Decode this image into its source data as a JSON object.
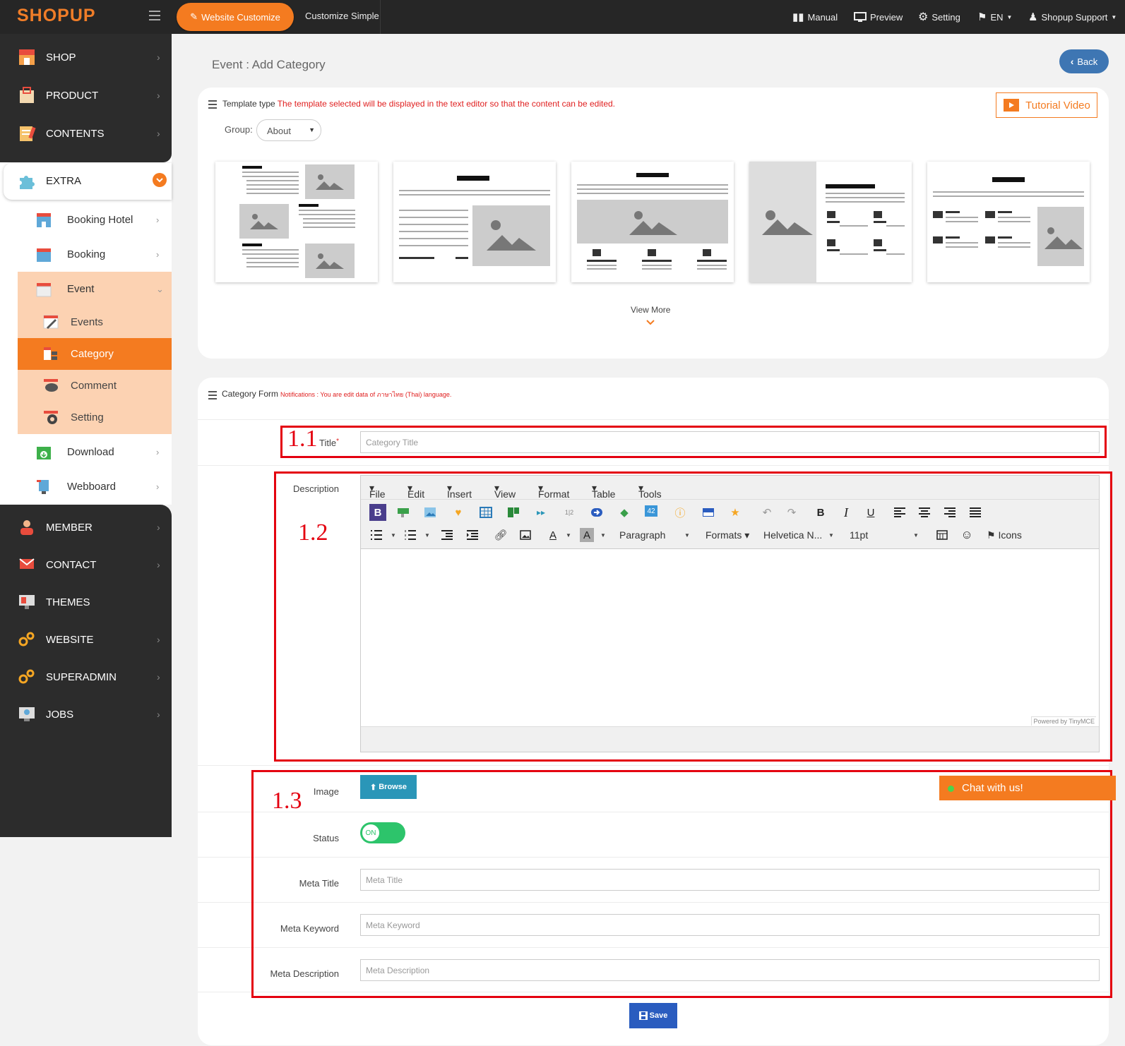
{
  "topbar": {
    "logo": "SHOPUP",
    "website_customize": "Website Customize",
    "customize_simple": "Customize Simple",
    "manual": "Manual",
    "preview": "Preview",
    "setting": "Setting",
    "language": "EN",
    "support": "Shopup Support"
  },
  "sidebar": {
    "shop": "SHOP",
    "product": "PRODUCT",
    "contents": "CONTENTS",
    "extra": "EXTRA",
    "booking_hotel": "Booking Hotel",
    "booking": "Booking",
    "event": "Event",
    "events": "Events",
    "category": "Category",
    "comment": "Comment",
    "setting": "Setting",
    "download": "Download",
    "webboard": "Webboard",
    "member": "MEMBER",
    "contact": "CONTACT",
    "themes": "THEMES",
    "website": "WEBSITE",
    "superadmin": "SUPERADMIN",
    "jobs": "JOBS"
  },
  "page": {
    "title": "Event : Add Category",
    "back": "Back"
  },
  "template_panel": {
    "label": "Template type",
    "notice": "The template selected will be displayed in the text editor so that the content can be edited.",
    "tutorial": "Tutorial Video",
    "group_label": "Group:",
    "group_value": "About",
    "view_more": "View More"
  },
  "form": {
    "header": "Category Form",
    "notice": "Notifications : You are edit data of ภาษาไทย (Thai) language.",
    "title_label": "Title",
    "required": "*",
    "title_placeholder": "Category Title",
    "description_label": "Description",
    "image_label": "Image",
    "browse": "Browse",
    "status_label": "Status",
    "status_value": "ON",
    "meta_title_label": "Meta Title",
    "meta_title_placeholder": "Meta Title",
    "meta_keyword_label": "Meta Keyword",
    "meta_keyword_placeholder": "Meta Keyword",
    "meta_description_label": "Meta Description",
    "meta_description_placeholder": "Meta Description",
    "save": "Save"
  },
  "editor": {
    "menus": [
      "File",
      "Edit",
      "Insert",
      "View",
      "Format",
      "Table",
      "Tools"
    ],
    "paragraph": "Paragraph",
    "formats": "Formats",
    "font": "Helvetica N...",
    "size": "11pt",
    "icons": "Icons",
    "powered": "Powered by TinyMCE"
  },
  "annotations": {
    "a1": "1.1",
    "a2": "1.2",
    "a3": "1.3"
  },
  "chat": "Chat with us!",
  "colors": {
    "accent": "#f47b20",
    "sidebar": "#2c2c2c",
    "highlight_red": "#e4000f",
    "back_blue": "#3e76b3",
    "browse": "#2a96b8",
    "save": "#2a5cbf",
    "toggle_on": "#2dc46b"
  }
}
